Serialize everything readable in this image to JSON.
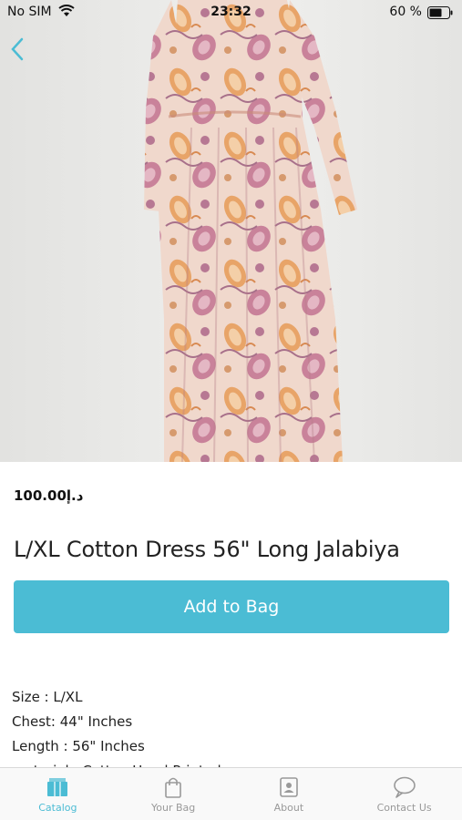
{
  "status_bar": {
    "carrier": "No SIM",
    "time": "23:32",
    "battery_percent": "60 %"
  },
  "product": {
    "price": "د.إ100.00",
    "title": "L/XL Cotton Dress 56\" Long Jalabiya",
    "add_to_bag_label": "Add to Bag",
    "description_lines": [
      "Size : L/XL",
      "Chest: 44\" Inches",
      "Length : 56\" Inches",
      "material : Cotton Hand Printed"
    ]
  },
  "tabs": [
    {
      "label": "Catalog",
      "icon": "catalog-icon",
      "active": true
    },
    {
      "label": "Your Bag",
      "icon": "bag-icon",
      "active": false
    },
    {
      "label": "About",
      "icon": "about-icon",
      "active": false
    },
    {
      "label": "Contact Us",
      "icon": "chat-bubble-icon",
      "active": false
    }
  ],
  "colors": {
    "accent": "#4bbcd4",
    "inactive_tab": "#999999"
  }
}
